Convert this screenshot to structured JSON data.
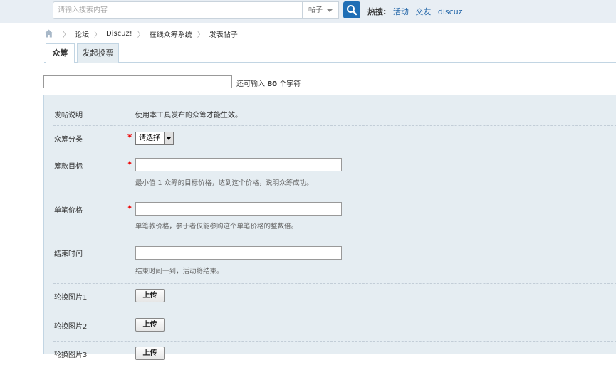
{
  "search": {
    "placeholder": "请输入搜索内容",
    "type_label": "帖子",
    "hot_label": "热搜:",
    "hot_links": [
      "活动",
      "交友",
      "discuz"
    ]
  },
  "breadcrumb": [
    "论坛",
    "Discuz!",
    "在线众筹系统",
    "发表帖子"
  ],
  "tabs": [
    {
      "label": "众筹",
      "active": true
    },
    {
      "label": "发起投票",
      "active": false
    }
  ],
  "subject": {
    "value": "",
    "hint_prefix": "还可输入",
    "hint_count": "80",
    "hint_suffix": "个字符"
  },
  "form": {
    "notice": {
      "label": "发帖说明",
      "text": "使用本工具发布的众筹才能生效。"
    },
    "category": {
      "label": "众筹分类",
      "selected": "请选择"
    },
    "goal": {
      "label": "筹款目标",
      "value": "",
      "help": "最小值 1  众筹的目标价格，达到这个价格，说明众筹成功。"
    },
    "unit_price": {
      "label": "单笔价格",
      "value": "",
      "help": "单笔款价格，参于者仅能参购这个单笔价格的整数倍。"
    },
    "end_time": {
      "label": "结束时间",
      "value": "",
      "help": "结束时间一到，活动将结束。"
    },
    "image1": {
      "label": "轮换图片1",
      "button": "上传"
    },
    "image2": {
      "label": "轮换图片2",
      "button": "上传"
    },
    "image3": {
      "label": "轮换图片3",
      "button": "上传"
    },
    "required_mark": "*"
  }
}
